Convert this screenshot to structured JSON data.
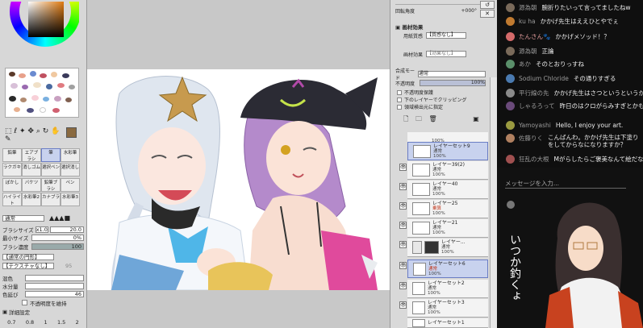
{
  "left_panel": {
    "tool_labels": [
      "鉛筆",
      "エアブラシ",
      "筆",
      "水彩筆",
      "ラクガキ",
      "消しゴム",
      "選択ペン",
      "選択消し",
      "ぼかし",
      "バケツ",
      "鉛筆ブラシ",
      "ペン",
      "ハイライト",
      "水彩筆2",
      "カナブラ",
      "水彩筆3"
    ],
    "blend_mode": "通常",
    "brush_size_label": "ブラシサイズ",
    "brush_size_mult": "x1.0",
    "brush_size_value": "20.0",
    "min_size_label": "最小サイズ",
    "min_size_value": "0%",
    "density_label": "ブラシ濃度",
    "density_value": "100",
    "shape_normal": "【通常の円形】",
    "texture_none": "【テクスチャなし】",
    "texture_value": "95",
    "mix_label": "混色",
    "water_label": "水分量",
    "color_stretch_label": "色延び",
    "color_stretch_value": "46",
    "keep_opacity_label": "不透明度を維持",
    "detail_settings_label": "詳細設定",
    "size_presets": [
      "0.7",
      "0.8",
      "1",
      "1.5",
      "2"
    ]
  },
  "layer_panel": {
    "top_values": [
      "回転角度"
    ],
    "rotation_value": "+000°",
    "paper_effect_header": "画材効果",
    "paper_texture_label": "用紙質感",
    "paper_texture_value": "【質感なし】",
    "material_effect_label": "画材効果",
    "material_effect_value": "【効果なし】",
    "blend_mode_label": "合成モード",
    "blend_mode_value": "通常",
    "opacity_label": "不透明度",
    "opacity_value": "100%",
    "protect_opacity": "不透明度保護",
    "clipping": "下のレイヤーでクリッピング",
    "select_source": "領域検出元に指定",
    "layers": [
      {
        "name": "",
        "mode": "通常",
        "opacity": "100%",
        "flag": "保護"
      },
      {
        "name": "レイヤーセット9",
        "mode": "通常",
        "opacity": "100%",
        "flag": ""
      },
      {
        "name": "レイヤー39(2)",
        "mode": "通常",
        "opacity": "100%",
        "flag": "保護"
      },
      {
        "name": "レイヤー40",
        "mode": "通常",
        "opacity": "100%",
        "flag": "保護"
      },
      {
        "name": "レイヤー25",
        "mode": "乗算",
        "opacity": "100%",
        "flag": "保護"
      },
      {
        "name": "レイヤー21",
        "mode": "通常",
        "opacity": "100%",
        "flag": "保護"
      },
      {
        "name": "レイヤー...",
        "mode": "通常",
        "opacity": "100%",
        "flag": ""
      },
      {
        "name": "レイヤーセット6",
        "mode": "通常",
        "opacity": "100%",
        "flag": ""
      },
      {
        "name": "レイヤーセット2",
        "mode": "通常",
        "opacity": "100%",
        "flag": ""
      },
      {
        "name": "レイヤーセット3",
        "mode": "通常",
        "opacity": "100%",
        "flag": ""
      },
      {
        "name": "レイヤーセット1",
        "mode": "",
        "opacity": "",
        "flag": ""
      }
    ]
  },
  "chat": {
    "messages": [
      {
        "name": "源為朝",
        "text": "腕折りたいって言ってましたねw",
        "color": "#7a6a5a"
      },
      {
        "name": "ku ha",
        "text": "かかげ先生はええひとやでぇ",
        "color": "#c07a30"
      },
      {
        "name": "たんさん🐾",
        "text": "かかげメソッド！？",
        "color": "#d46a6a"
      },
      {
        "name": "源為朝",
        "text": "正論",
        "color": "#7a6a5a"
      },
      {
        "name": "あか",
        "text": "そのとおりっすね",
        "color": "#5a8f6a"
      },
      {
        "name": "Sodium Chloride",
        "text": "その通りすぎる",
        "color": "#4a7ab0"
      },
      {
        "name": "平行線の先",
        "text": "かかげ先生はさつというというが考えすぎ",
        "color": "#8a8a8a"
      },
      {
        "name": "しゃるろって",
        "text": "昨日のはクロがらみすぎとかもしれ",
        "color": "#6a4a7a"
      },
      {
        "name": "Yamoyashi",
        "text": "Hello, I enjoy your art.",
        "color": "#9a9a40"
      },
      {
        "name": "佐藤りく",
        "text": "こんばんわ。かかげ先生は下塗りをしてからなになりますか？",
        "color": "#b08060"
      },
      {
        "name": "狂乱の大根",
        "text": "Mがらしたらご褒美なんて絵だな",
        "color": "#a05050"
      }
    ],
    "input_placeholder": "メッセージを入力...",
    "vtuber_text": "いつか釣くょ"
  }
}
